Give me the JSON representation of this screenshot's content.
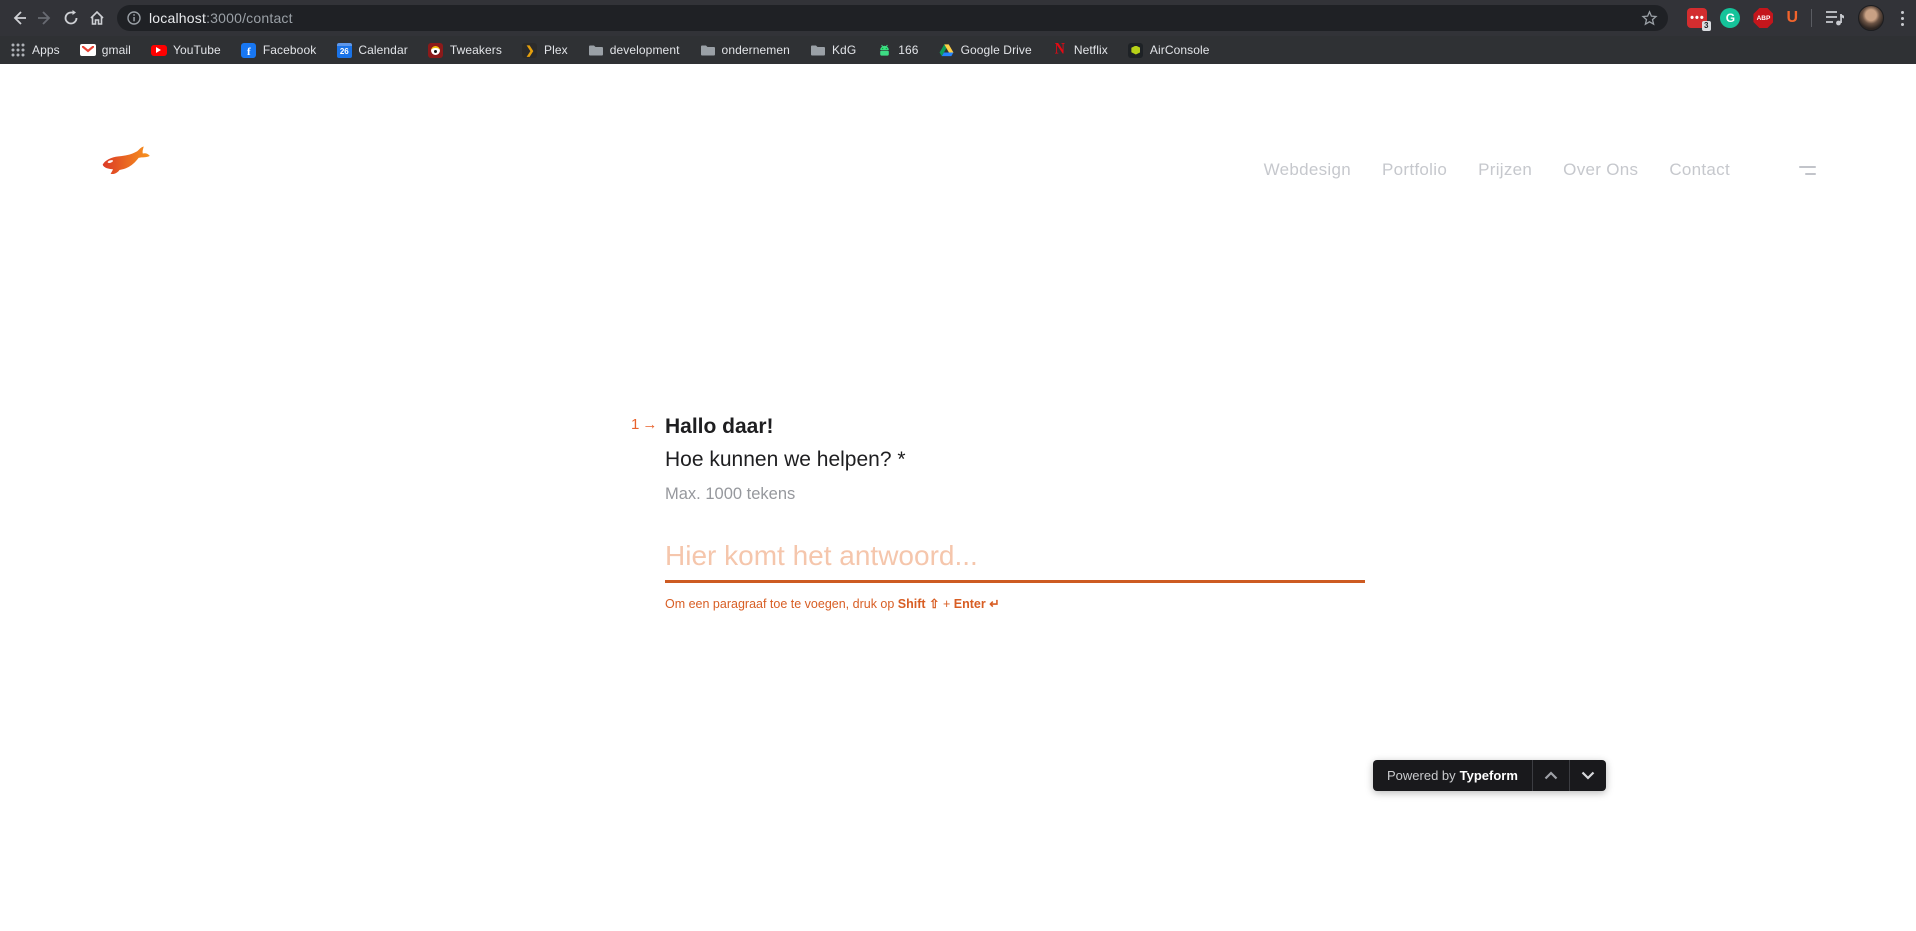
{
  "browser": {
    "toolbar": {
      "url_host": "localhost",
      "url_path": ":3000/contact",
      "extension_badge": "3",
      "abp_label": "ABP",
      "u_label": "U"
    },
    "bookmarks": [
      {
        "label": "Apps",
        "icon": "apps-grid-icon"
      },
      {
        "label": "gmail",
        "icon": "gmail-icon"
      },
      {
        "label": "YouTube",
        "icon": "youtube-icon"
      },
      {
        "label": "Facebook",
        "icon": "facebook-icon"
      },
      {
        "label": "Calendar",
        "icon": "calendar-icon",
        "day": "26"
      },
      {
        "label": "Tweakers",
        "icon": "tweakers-icon"
      },
      {
        "label": "Plex",
        "icon": "plex-icon",
        "glyph": "❯"
      },
      {
        "label": "development",
        "icon": "folder-icon"
      },
      {
        "label": "ondernemen",
        "icon": "folder-icon"
      },
      {
        "label": "KdG",
        "icon": "folder-icon"
      },
      {
        "label": "166",
        "icon": "android-icon"
      },
      {
        "label": "Google Drive",
        "icon": "google-drive-icon"
      },
      {
        "label": "Netflix",
        "icon": "netflix-icon",
        "glyph": "N"
      },
      {
        "label": "AirConsole",
        "icon": "airconsole-icon"
      }
    ]
  },
  "header": {
    "nav": [
      {
        "label": "Webdesign"
      },
      {
        "label": "Portfolio"
      },
      {
        "label": "Prijzen"
      },
      {
        "label": "Over Ons"
      },
      {
        "label": "Contact"
      }
    ]
  },
  "form": {
    "question_number": "1",
    "question_arrow": "→",
    "title": "Hallo daar!",
    "subtitle": "Hoe kunnen we helpen? *",
    "max_hint": "Max. 1000 tekens",
    "answer_placeholder": "Hier komt het antwoord...",
    "answer_value": "",
    "paragraph_hint_prefix": "Om een paragraaf toe te voegen, druk op ",
    "paragraph_hint_shift": "Shift ⇧",
    "paragraph_hint_plus": " + ",
    "paragraph_hint_enter": "Enter ↵"
  },
  "widget": {
    "powered_by": "Powered by",
    "brand": "Typeform"
  },
  "colors": {
    "accent_orange": "#E8622C",
    "underline_orange": "#CD5B22",
    "placeholder_orange": "#F5C6AC",
    "hint_orange": "#D85E24",
    "nav_gray": "#C6C8CD",
    "logo_gradient_start": "#DC3A26",
    "logo_gradient_end": "#F7941E",
    "widget_bg": "#19191C"
  }
}
